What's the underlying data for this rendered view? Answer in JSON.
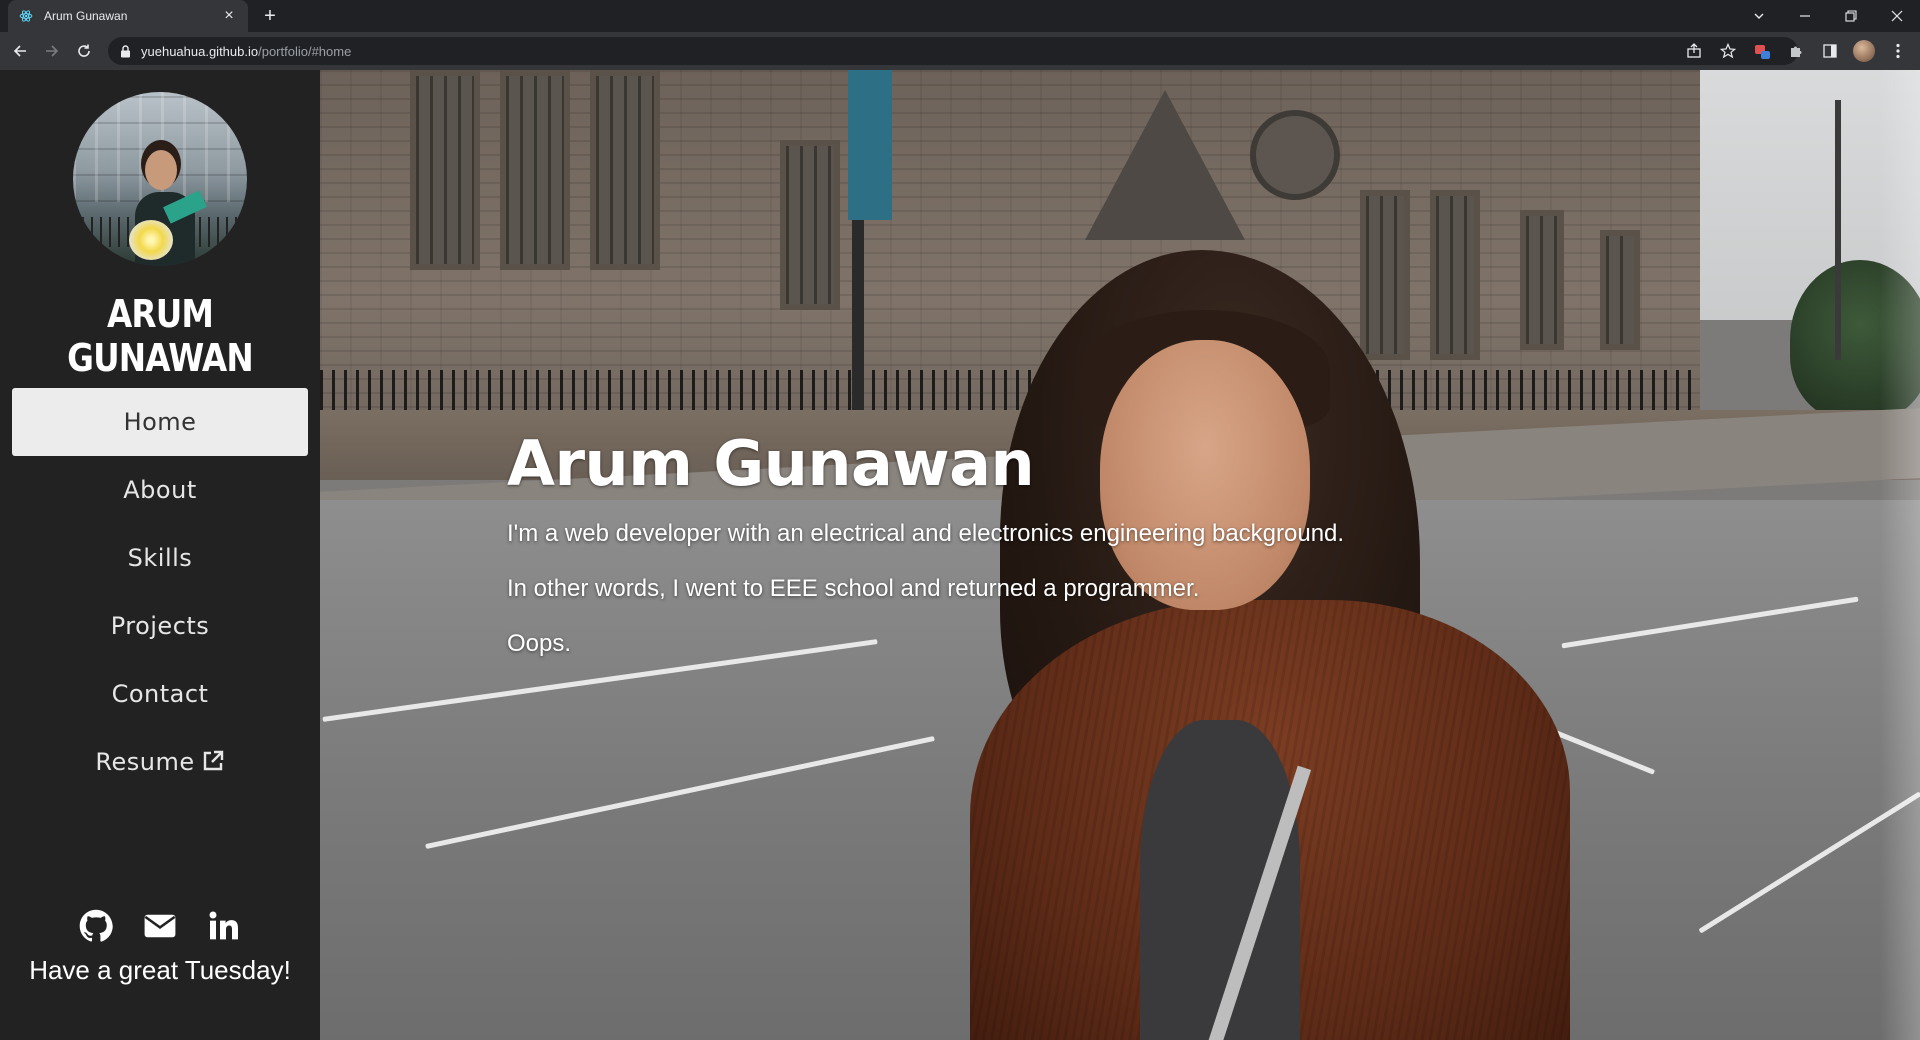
{
  "browser": {
    "tab_title": "Arum Gunawan",
    "url_domain": "yuehuahua.github.io",
    "url_path": "/portfolio/#home",
    "new_tab_symbol": "+",
    "close_symbol": "×"
  },
  "sidebar": {
    "brand": "ARUM GUNAWAN",
    "nav": [
      {
        "label": "Home",
        "active": true
      },
      {
        "label": "About",
        "active": false
      },
      {
        "label": "Skills",
        "active": false
      },
      {
        "label": "Projects",
        "active": false
      },
      {
        "label": "Contact",
        "active": false
      },
      {
        "label": "Resume",
        "active": false,
        "icon": "external-link-icon"
      }
    ],
    "social": [
      "github-icon",
      "mail-icon",
      "linkedin-icon"
    ],
    "greeting": "Have a great Tuesday!"
  },
  "hero": {
    "title": "Arum Gunawan",
    "lines": [
      "I'm a web developer with an electrical and electronics engineering background.",
      "In other words, I went to EEE school and returned a programmer.",
      "Oops."
    ]
  },
  "colors": {
    "sidebar_bg": "#222222",
    "active_nav_bg": "#ececec",
    "chrome_dark": "#202124",
    "chrome_toolbar": "#35363a"
  }
}
